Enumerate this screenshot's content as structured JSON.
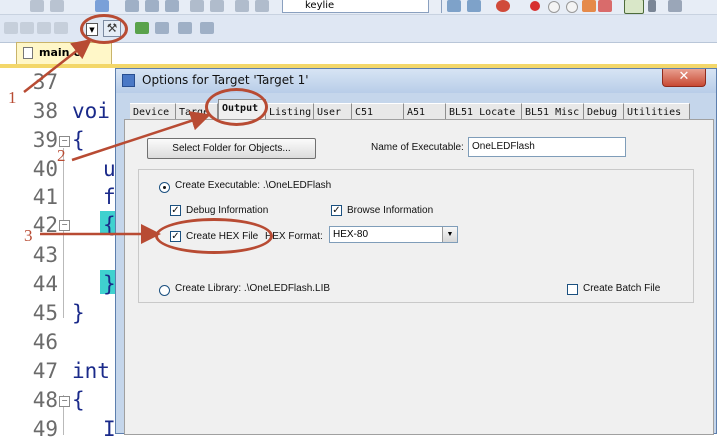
{
  "toolbar": {
    "search_value": "keylie"
  },
  "file_tab": {
    "label": "main.c"
  },
  "editor": {
    "lines": [
      {
        "num": "37",
        "code": ""
      },
      {
        "num": "38",
        "code": "voi"
      },
      {
        "num": "39",
        "code": "{"
      },
      {
        "num": "40",
        "code": "u"
      },
      {
        "num": "41",
        "code": "f"
      },
      {
        "num": "42",
        "code": "{"
      },
      {
        "num": "43",
        "code": ""
      },
      {
        "num": "44",
        "code": "}"
      },
      {
        "num": "45",
        "code": "}"
      },
      {
        "num": "46",
        "code": ""
      },
      {
        "num": "47",
        "code": "int"
      },
      {
        "num": "48",
        "code": "{"
      },
      {
        "num": "49",
        "code": "I"
      }
    ]
  },
  "dialog": {
    "title": "Options for Target 'Target 1'",
    "close_icon": "close-icon",
    "tabs": [
      {
        "label": "Device"
      },
      {
        "label": "Targe"
      },
      {
        "label": "Output"
      },
      {
        "label": "Listing"
      },
      {
        "label": "User"
      },
      {
        "label": "C51"
      },
      {
        "label": "A51"
      },
      {
        "label": "BL51 Locate"
      },
      {
        "label": "BL51 Misc"
      },
      {
        "label": "Debug"
      },
      {
        "label": "Utilities"
      }
    ],
    "active_tab": "Output",
    "select_folder_button": "Select Folder for Objects...",
    "name_of_executable_label": "Name of Executable:",
    "name_of_executable_value": "OneLEDFlash",
    "create_executable_label": "Create Executable:  .\\OneLEDFlash",
    "debug_information_label": "Debug Information",
    "browse_information_label": "Browse Information",
    "create_hex_label": "Create HEX File",
    "hex_format_label": "HEX Format:",
    "hex_format_value": "HEX-80",
    "create_library_label": "Create Library:  .\\OneLEDFlash.LIB",
    "create_batch_label": "Create Batch File",
    "checkbox_mark": "✓"
  },
  "annotations": {
    "n1": "1",
    "n2": "2",
    "n3": "3"
  },
  "colors": {
    "annotation": "#b84b33",
    "line_highlight": "#3fd1cf"
  }
}
